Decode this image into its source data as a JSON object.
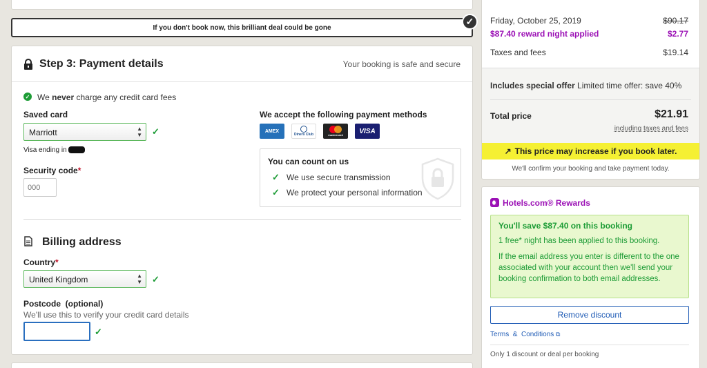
{
  "alert": {
    "text": "If you don't book now, this brilliant deal could be gone"
  },
  "step": {
    "title": "Step 3: Payment details",
    "secure_text": "Your booking is safe and secure"
  },
  "fees": {
    "prefix": "We ",
    "emphasis": "never",
    "suffix": " charge any credit card fees"
  },
  "saved_card": {
    "label": "Saved card",
    "value": "Marriott",
    "note": "Visa ending in"
  },
  "security_code": {
    "label": "Security code",
    "required": "*",
    "placeholder": "000"
  },
  "payment_methods": {
    "heading": "We accept the following payment methods",
    "cards": [
      "AMEX",
      "Diners Club",
      "mastercard",
      "VISA"
    ]
  },
  "trust": {
    "heading": "You can count on us",
    "items": [
      "We use secure transmission",
      "We protect your personal information"
    ]
  },
  "billing": {
    "title": "Billing address",
    "country_label": "Country",
    "country_required": "*",
    "country_value": "United Kingdom",
    "postcode_label": "Postcode  (optional)",
    "postcode_hint": "We'll use this to verify your credit card details"
  },
  "summary": {
    "date": "Friday, October 25, 2019",
    "date_price": "$90.17",
    "reward_label": "$87.40 reward night applied",
    "reward_price": "$2.77",
    "taxes_label": "Taxes and fees",
    "taxes_price": "$19.14",
    "offer_strong": "Includes special offer",
    "offer_text": " Limited time offer: save 40%",
    "total_label": "Total price",
    "total_value": "$21.91",
    "total_note": "including taxes and fees",
    "increase_text": "This price may increase if you book later.",
    "confirm_text": "We'll confirm your booking and take payment today."
  },
  "rewards": {
    "title": "Hotels.com® Rewards",
    "save_heading": "You'll save $87.40 on this booking",
    "free_night": "1 free* night has been applied to this booking.",
    "email_note": "If the email address you enter is different to the one associated with your account then we'll send your booking confirmation to both email addresses.",
    "remove_button": "Remove discount",
    "terms_link": "Terms  &  Conditions",
    "only_one": "Only 1 discount or deal per booking"
  },
  "colors": {
    "purple": "#9b10b5",
    "green": "#1d9c36",
    "yellow": "#f5f033",
    "link": "#1f5bb5"
  }
}
